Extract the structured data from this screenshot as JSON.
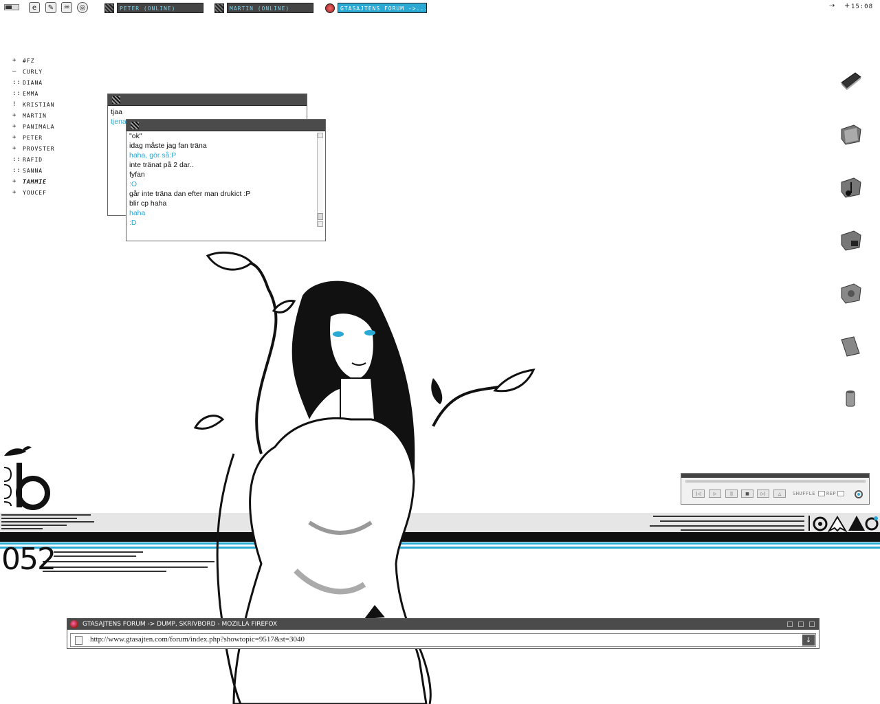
{
  "taskbar": {
    "quick_launch": [
      "show-desktop-icon",
      "internet-explorer-icon",
      "feather-icon",
      "winamp-icon",
      "settings-icon"
    ],
    "tasks": [
      {
        "label": "PETER (ONLINE)",
        "active": false
      },
      {
        "label": "MARTIN (ONLINE)",
        "active": false
      },
      {
        "label": "GTASAJTENS FORUM ->...",
        "active": true
      }
    ],
    "tray_arrow": "⇢",
    "tray_plus": "+",
    "clock": "15:08"
  },
  "contacts": [
    {
      "status": "+",
      "name": "#FZ"
    },
    {
      "status": "—",
      "name": "CURLY"
    },
    {
      "status": "::",
      "name": "DIANA"
    },
    {
      "status": "::",
      "name": "EMMA"
    },
    {
      "status": "!",
      "name": "KRISTIAN"
    },
    {
      "status": "+",
      "name": "MARTIN"
    },
    {
      "status": "+",
      "name": "PANIMALA"
    },
    {
      "status": "+",
      "name": "PETER"
    },
    {
      "status": "+",
      "name": "PROVSTER"
    },
    {
      "status": "::",
      "name": "RAFID"
    },
    {
      "status": "::",
      "name": "SANNA"
    },
    {
      "status": "+",
      "name": "TAMMIE"
    },
    {
      "status": "+",
      "name": "YOUCEF"
    }
  ],
  "chat_back": {
    "lines": [
      {
        "text": "tjaa",
        "color": "black"
      },
      {
        "text": "tjena",
        "color": "blue"
      }
    ]
  },
  "chat_front": {
    "lines": [
      {
        "text": "\"ok\"",
        "color": "black"
      },
      {
        "text": "idag måste jag fan träna",
        "color": "black"
      },
      {
        "text": "haha, gör så:P",
        "color": "blue"
      },
      {
        "text": "inte tränat på 2 dar..",
        "color": "black"
      },
      {
        "text": "fyfan",
        "color": "black"
      },
      {
        "text": ":O",
        "color": "blue"
      },
      {
        "text": "går inte träna dan efter man drukict :P",
        "color": "black"
      },
      {
        "text": "blir cp haha",
        "color": "black"
      },
      {
        "text": "haha",
        "color": "blue"
      },
      {
        "text": ":D",
        "color": "blue"
      }
    ]
  },
  "desktop_icons": [
    "my-computer-icon",
    "folder-icon",
    "music-folder-icon",
    "network-folder-icon",
    "favorites-folder-icon",
    "documents-folder-icon",
    "recycle-bin-icon"
  ],
  "player": {
    "buttons": [
      "|◁",
      "▷",
      "||",
      "■",
      "▷|",
      "△"
    ],
    "shuffle_label": "SHUFFLE",
    "repeat_label": "REP"
  },
  "firefox": {
    "title": "GTASAJTENS FORUM -> DUMP, SKRIVBORD - MOZILLA FIREFOX",
    "url": "http://www.gtasajten.com/forum/index.php?showtopic=9517&st=3040"
  },
  "wallpaper": {
    "big_number": "052",
    "vertical_number": "J305"
  },
  "colors": {
    "accent": "#29a9d4",
    "titlebar": "#4b4b4b",
    "ink": "#111111"
  }
}
